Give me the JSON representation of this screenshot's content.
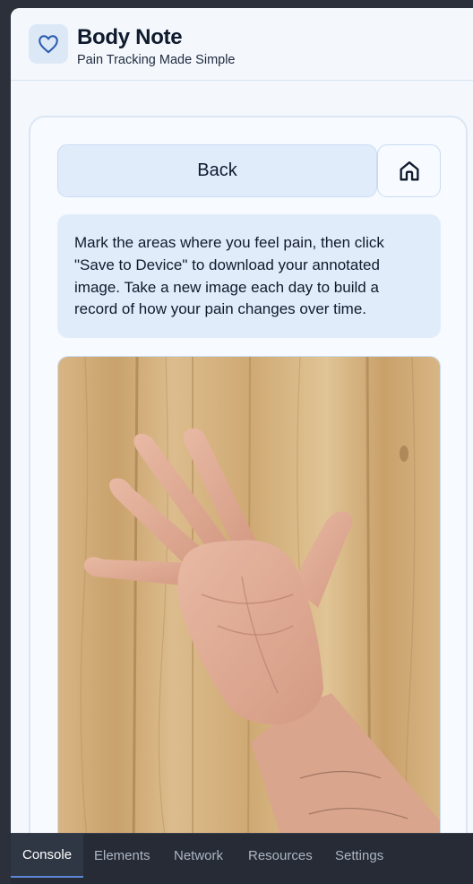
{
  "app": {
    "title": "Body Note",
    "subtitle": "Pain Tracking Made Simple",
    "logo_icon": "heart-icon"
  },
  "controls": {
    "back_label": "Back",
    "home_icon": "home-icon"
  },
  "instructions": {
    "text": "Mark the areas where you feel pain, then click \"Save to Device\" to download your annotated image. Take a new image each day to build a record of how your pain changes over time."
  },
  "photo": {
    "subject": "hand-photo"
  },
  "devtools": {
    "tabs": [
      {
        "label": "Console",
        "active": true
      },
      {
        "label": "Elements",
        "active": false
      },
      {
        "label": "Network",
        "active": false
      },
      {
        "label": "Resources",
        "active": false
      },
      {
        "label": "Settings",
        "active": false
      }
    ]
  },
  "colors": {
    "accent": "#2a5cae",
    "panel_bg": "#e1ecfb",
    "devtools_bg": "#262b35"
  }
}
